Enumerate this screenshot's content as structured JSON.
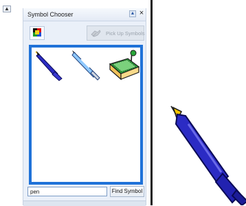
{
  "panel": {
    "title": "Symbol Chooser",
    "pin_glyph": "▲",
    "close_glyph": "×",
    "palette_icon": "palette-icon",
    "pickup_label": "Pick Up Symbols",
    "pickup_icon": "hand-pickup-icon",
    "symbols": [
      "pen-icon",
      "ballpoint-pen-icon",
      "pen-holder-tray-icon"
    ],
    "search_value": "pen",
    "find_label": "Find Symbol",
    "border_color": "#1f72d8"
  },
  "gutter": {
    "glyph": "▲"
  },
  "canvas": {
    "item": "fountain-pen-drawing"
  }
}
